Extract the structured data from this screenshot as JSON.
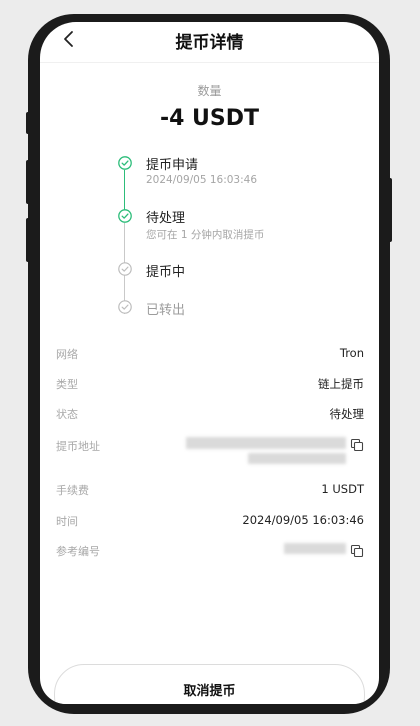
{
  "header": {
    "title": "提币详情",
    "back_icon": "chevron-left-icon"
  },
  "amount": {
    "label": "数量",
    "value": "-4 USDT"
  },
  "timeline": {
    "accent_color": "#2dbd7a",
    "steps": [
      {
        "title": "提币申请",
        "subtitle": "2024/09/05 16:03:46",
        "status": "done",
        "icon": "check-circle-icon"
      },
      {
        "title": "待处理",
        "subtitle": "您可在 1 分钟内取消提币",
        "status": "done",
        "icon": "check-circle-icon"
      },
      {
        "title": "提币中",
        "status": "pending",
        "icon": "check-circle-icon"
      },
      {
        "title": "已转出",
        "status": "pending",
        "icon": "check-circle-icon"
      }
    ]
  },
  "details": {
    "network": {
      "label": "网络",
      "value": "Tron"
    },
    "type": {
      "label": "类型",
      "value": "链上提币"
    },
    "status": {
      "label": "状态",
      "value": "待处理"
    },
    "address": {
      "label": "提币地址",
      "redacted": true,
      "icon": "copy-icon"
    },
    "fee": {
      "label": "手续费",
      "value": "1 USDT"
    },
    "time": {
      "label": "时间",
      "value": "2024/09/05 16:03:46"
    },
    "reference": {
      "label": "参考编号",
      "redacted": true,
      "icon": "copy-icon"
    }
  },
  "footer": {
    "cancel_label": "取消提币"
  }
}
